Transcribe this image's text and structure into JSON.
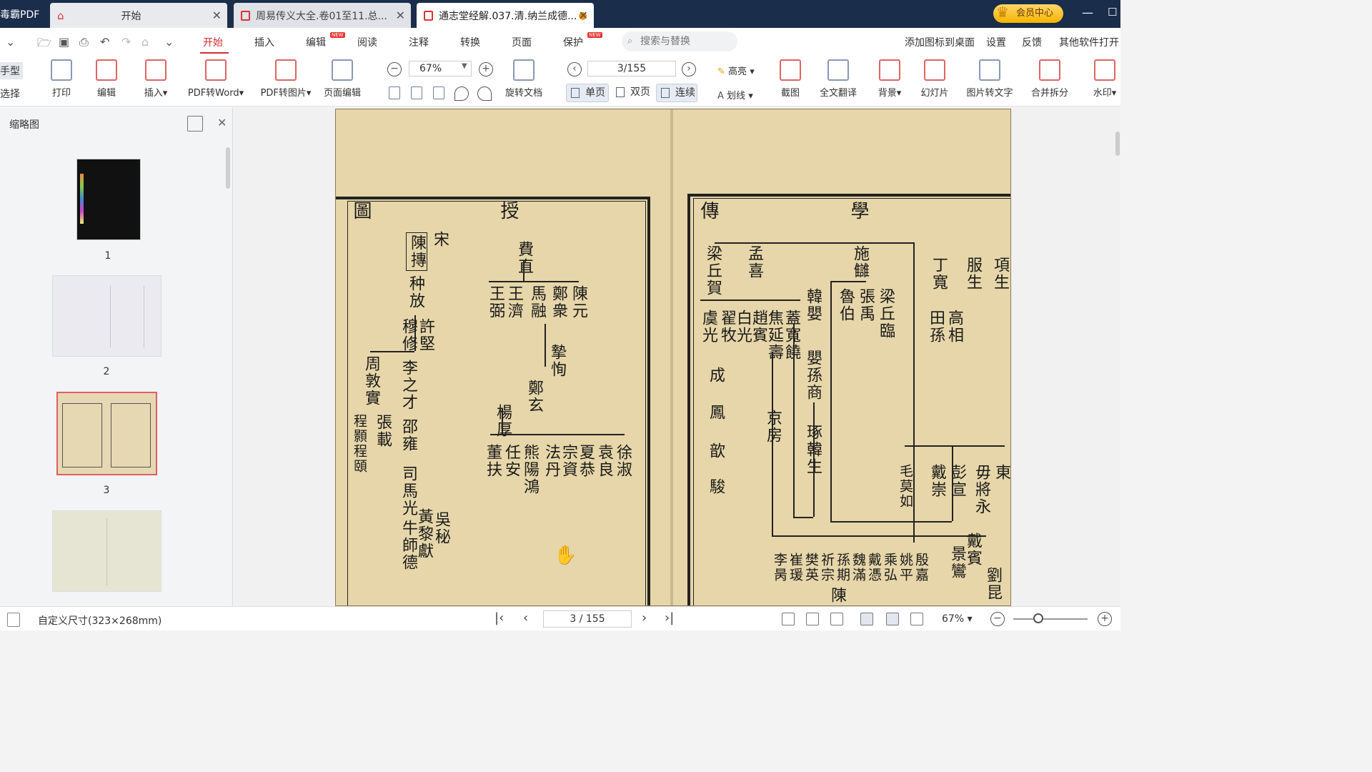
{
  "app": {
    "name": "毒霸PDF"
  },
  "tabs": [
    {
      "label": "开始"
    },
    {
      "label": "周易传义大全.卷01至11.总..."
    },
    {
      "label": "通志堂经解.037.清.纳兰成德..."
    }
  ],
  "vip": {
    "label": "会员中心"
  },
  "quick_access": [
    "down-arrow",
    "open",
    "save",
    "print",
    "undo",
    "redo",
    "home",
    "more"
  ],
  "menu": {
    "items": [
      "开始",
      "插入",
      "编辑",
      "阅读",
      "注释",
      "转换",
      "页面",
      "保护"
    ],
    "active": "开始",
    "new_badge": "NEW",
    "search_placeholder": "搜索与替换",
    "right_links": [
      "添加图标到桌面",
      "设置",
      "反馈",
      "其他软件打开"
    ]
  },
  "ribbon": {
    "side_labels": [
      "手型",
      "选择"
    ],
    "buttons": [
      "打印",
      "编辑",
      "插入",
      "PDF转Word",
      "PDF转图片",
      "页面编辑",
      "旋转文档",
      "截图",
      "全文翻译",
      "背景",
      "幻灯片",
      "图片转文字",
      "合并拆分",
      "水印"
    ],
    "zoom": "67%",
    "page": "3/155",
    "views": [
      "单页",
      "双页",
      "连续"
    ],
    "highlight": "高亮",
    "strike": "划线"
  },
  "thumbnails": {
    "title": "缩略图",
    "pages": [
      "1",
      "2",
      "3"
    ]
  },
  "document": {
    "columns_left": [
      "圖",
      "授",
      "宋",
      "陳摶",
      "种放",
      "許堅",
      "穆修",
      "李之才",
      "周敦實",
      "程顥程頤",
      "張載",
      "邵雍",
      "司馬光",
      "牛師德",
      "黃黎獻",
      "吳秘",
      "費直",
      "王弼",
      "王濟",
      "馬融",
      "鄭衆",
      "陳元",
      "摯恂",
      "鄭玄",
      "楊厚",
      "董扶",
      "任安",
      "熊陽鴻",
      "法丹",
      "宗資",
      "夏恭",
      "袁良",
      "徐淑",
      "李之才"
    ],
    "columns_right": [
      "傳",
      "學",
      "梁丘賀",
      "孟喜",
      "施讎",
      "丁寬",
      "服生",
      "項生",
      "韓嬰",
      "魯伯",
      "張禹",
      "梁丘臨",
      "田孫",
      "高相",
      "虞光",
      "翟牧",
      "白光",
      "趙賓",
      "焦延壽",
      "蓋寬饒",
      "嬰孫商",
      "京房",
      "琢韓生",
      "成",
      "鳳",
      "歆",
      "駿",
      "毛莫如",
      "戴崇",
      "彭宣",
      "毋將永",
      "東",
      "戴賓",
      "景鸞",
      "劉昆",
      "陳",
      "殷嘉",
      "姚平",
      "乘弘",
      "戴憑",
      "魏滿",
      "孫期",
      "祈宗",
      "樊英",
      "崔瑗",
      "李昺"
    ]
  },
  "status": {
    "page_size": "自定义尺寸(323×268mm)",
    "page": "3 / 155",
    "zoom": "67%"
  }
}
